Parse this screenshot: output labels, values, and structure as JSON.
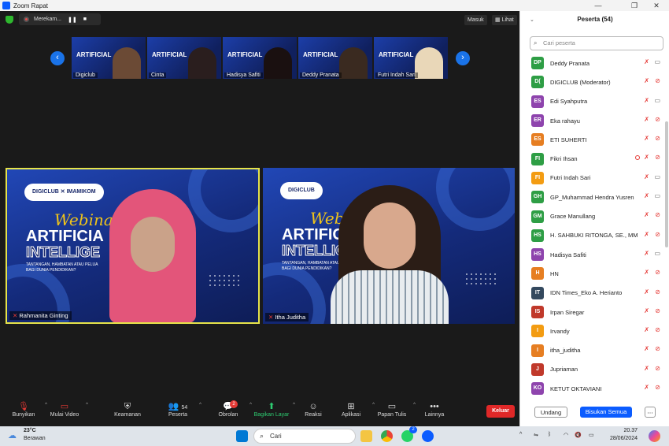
{
  "window": {
    "title": "Zoom Rapat",
    "min": "—",
    "max": "❐",
    "close": "✕"
  },
  "recording": {
    "label": "Merekam...",
    "pause": "❚❚",
    "stop": "■"
  },
  "top_buttons": {
    "enter": "Masuk",
    "view": "Lihat"
  },
  "thumbnails": [
    {
      "label": "Digiclub",
      "title": "ARTIFICIAL",
      "person_color": "#6b4a35"
    },
    {
      "label": "Cinta",
      "title": "ARTIFICIAL",
      "person_color": "#2a1e1e"
    },
    {
      "label": "Hadisya Safiti",
      "title": "ARTIFICIAL",
      "person_color": "#1a1010"
    },
    {
      "label": "Deddy Pranata",
      "title": "ARTIFICIAL",
      "person_color": "#3a2a20"
    },
    {
      "label": "Futri Indah Sari",
      "title": "ARTIFICIAL",
      "person_color": "#e9d7b8"
    }
  ],
  "videos": [
    {
      "name": "Rahmanita Ginting",
      "logos": "DIGICLUB  ✕  IMAMIKOM",
      "webinar": "Webinar",
      "line1": "ARTIFICIA",
      "line2": "INTELLIGE",
      "sub1": "TANTANGAN, HAMBATAN ATAU PELUA",
      "sub2": "BAGI DUNIA PENDIDIKAN?"
    },
    {
      "name": "Itha Juditha",
      "logos": "DIGICLUB",
      "webinar": "Webin",
      "line1": "ARTIFICI",
      "line2": "INTELLIGE",
      "sub1": "TANTANGAN, HAMBATAN ATAU PEL",
      "sub2": "BAGI DUNIA PENDIDIKAN?"
    }
  ],
  "toolbar": {
    "unmute": "Bunyikan",
    "start_video": "Mulai Video",
    "security": "Keamanan",
    "participants": "Peserta",
    "participants_count": "54",
    "chat": "Obrolan",
    "chat_badge": "2",
    "share": "Bagikan Layar",
    "reactions": "Reaksi",
    "apps": "Aplikasi",
    "whiteboard": "Papan Tulis",
    "more": "Lainnya",
    "leave": "Keluar"
  },
  "panel": {
    "header": "Peserta (54)",
    "search_placeholder": "Cari peserta",
    "participants": [
      {
        "initials": "DP",
        "name": "Deddy Pranata",
        "color": "#2e9e45"
      },
      {
        "initials": "D(",
        "name": "DIGICLUB (Moderator)",
        "color": "#2e9e45"
      },
      {
        "initials": "ES",
        "name": "Edi Syahputra",
        "color": "#8e44ad"
      },
      {
        "initials": "ER",
        "name": "Eka rahayu",
        "color": "#8e44ad"
      },
      {
        "initials": "ES",
        "name": "ETI SUHERTI",
        "color": "#e67e22"
      },
      {
        "initials": "FI",
        "name": "Fikri Ihsan",
        "color": "#2e9e45"
      },
      {
        "initials": "FI",
        "name": "Futri Indah Sari",
        "color": "#f39c12"
      },
      {
        "initials": "GH",
        "name": "GP_Muhammad Hendra Yusren",
        "color": "#2e9e45"
      },
      {
        "initials": "GM",
        "name": "Grace Manullang",
        "color": "#2e9e45"
      },
      {
        "initials": "HS",
        "name": "H. SAHBUKI RITONGA, SE., MM",
        "color": "#2e9e45"
      },
      {
        "initials": "HS",
        "name": "Hadisya Safiti",
        "color": "#8e44ad"
      },
      {
        "initials": "H",
        "name": "HN",
        "color": "#e67e22"
      },
      {
        "initials": "IT",
        "name": "IDN Times_Eko A. Herianto",
        "color": "#34495e"
      },
      {
        "initials": "IS",
        "name": "Irpan Siregar",
        "color": "#c0392b"
      },
      {
        "initials": "I",
        "name": "Irvandy",
        "color": "#f39c12"
      },
      {
        "initials": "I",
        "name": "itha_juditha",
        "color": "#e67e22"
      },
      {
        "initials": "J",
        "name": "Jupriaman",
        "color": "#c0392b"
      },
      {
        "initials": "KO",
        "name": "KETUT OKTAVIANI",
        "color": "#8e44ad"
      }
    ],
    "invite": "Undang",
    "mute_all": "Bisukan Semua",
    "more": "⋯"
  },
  "taskbar": {
    "temp": "23°C",
    "weather": "Berawan",
    "search": "Cari",
    "time": "20.37",
    "date": "28/06/2024",
    "badge": "2"
  }
}
